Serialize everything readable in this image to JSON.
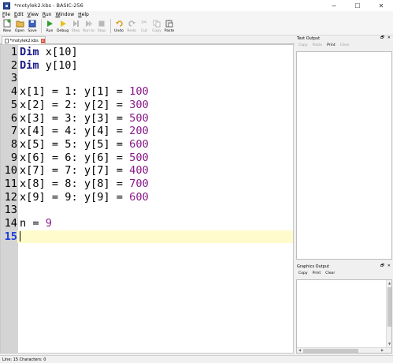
{
  "window": {
    "title": "*motylek2.kbs - BASIC-256",
    "min": "─",
    "max": "☐",
    "close": "✕"
  },
  "menu": [
    {
      "label": "File",
      "u": "F",
      "rest": "ile"
    },
    {
      "label": "Edit",
      "u": "E",
      "rest": "dit"
    },
    {
      "label": "View",
      "u": "V",
      "rest": "iew"
    },
    {
      "label": "Run",
      "u": "R",
      "rest": "un"
    },
    {
      "label": "Window",
      "u": "W",
      "rest": "indow"
    },
    {
      "label": "Help",
      "u": "H",
      "rest": "elp"
    }
  ],
  "toolbar": {
    "new": "New",
    "open": "Open",
    "save": "Save",
    "run": "Run",
    "debug": "Debug",
    "step": "Step",
    "run_to": "Run to",
    "stop": "Stop",
    "undo": "Undo",
    "redo": "Redo",
    "cut": "Cut",
    "copy": "Copy",
    "paste": "Paste"
  },
  "tab": {
    "label": "*motylek2.kbs",
    "close": "x"
  },
  "editor": {
    "lines": [
      {
        "n": "1",
        "tokens": [
          {
            "t": "Dim",
            "c": "kw"
          },
          {
            "t": " x[10]",
            "c": ""
          }
        ]
      },
      {
        "n": "2",
        "tokens": [
          {
            "t": "Dim",
            "c": "kw"
          },
          {
            "t": " y[10]",
            "c": ""
          }
        ]
      },
      {
        "n": "3",
        "tokens": []
      },
      {
        "n": "4",
        "tokens": [
          {
            "t": "x[1] = 1: y[1] = ",
            "c": ""
          },
          {
            "t": "100",
            "c": "numv"
          }
        ]
      },
      {
        "n": "5",
        "tokens": [
          {
            "t": "x[2] = 2: y[2] = ",
            "c": ""
          },
          {
            "t": "300",
            "c": "numv"
          }
        ]
      },
      {
        "n": "6",
        "tokens": [
          {
            "t": "x[3] = 3: y[3] = ",
            "c": ""
          },
          {
            "t": "500",
            "c": "numv"
          }
        ]
      },
      {
        "n": "7",
        "tokens": [
          {
            "t": "x[4] = 4: y[4] = ",
            "c": ""
          },
          {
            "t": "200",
            "c": "numv"
          }
        ]
      },
      {
        "n": "8",
        "tokens": [
          {
            "t": "x[5] = 5: y[5] = ",
            "c": ""
          },
          {
            "t": "600",
            "c": "numv"
          }
        ]
      },
      {
        "n": "9",
        "tokens": [
          {
            "t": "x[6] = 6: y[6] = ",
            "c": ""
          },
          {
            "t": "500",
            "c": "numv"
          }
        ]
      },
      {
        "n": "10",
        "tokens": [
          {
            "t": "x[7] = 7: y[7] = ",
            "c": ""
          },
          {
            "t": "400",
            "c": "numv"
          }
        ]
      },
      {
        "n": "11",
        "tokens": [
          {
            "t": "x[8] = 8: y[8] = ",
            "c": ""
          },
          {
            "t": "700",
            "c": "numv"
          }
        ]
      },
      {
        "n": "12",
        "tokens": [
          {
            "t": "x[9] = 9: y[9] = ",
            "c": ""
          },
          {
            "t": "600",
            "c": "numv"
          }
        ]
      },
      {
        "n": "13",
        "tokens": []
      },
      {
        "n": "14",
        "tokens": [
          {
            "t": "n = ",
            "c": ""
          },
          {
            "t": "9",
            "c": "numv"
          }
        ]
      },
      {
        "n": "15",
        "tokens": [],
        "current": true
      }
    ]
  },
  "text_output": {
    "title": "Text Output",
    "copy": "Copy",
    "paste": "Paste",
    "print": "Print",
    "clear": "Clear"
  },
  "graphics_output": {
    "title": "Graphics Output",
    "copy": "Copy",
    "print": "Print",
    "clear": "Clear"
  },
  "panel_buttons": {
    "float": "🗗",
    "close": "✕"
  },
  "status": "Line: 15 Characters: 0",
  "colors": {
    "keyword": "#1a1a8a",
    "number": "#8b1a8b",
    "current_line": "#fffbcc",
    "current_line_number": "#1e3fd8"
  }
}
